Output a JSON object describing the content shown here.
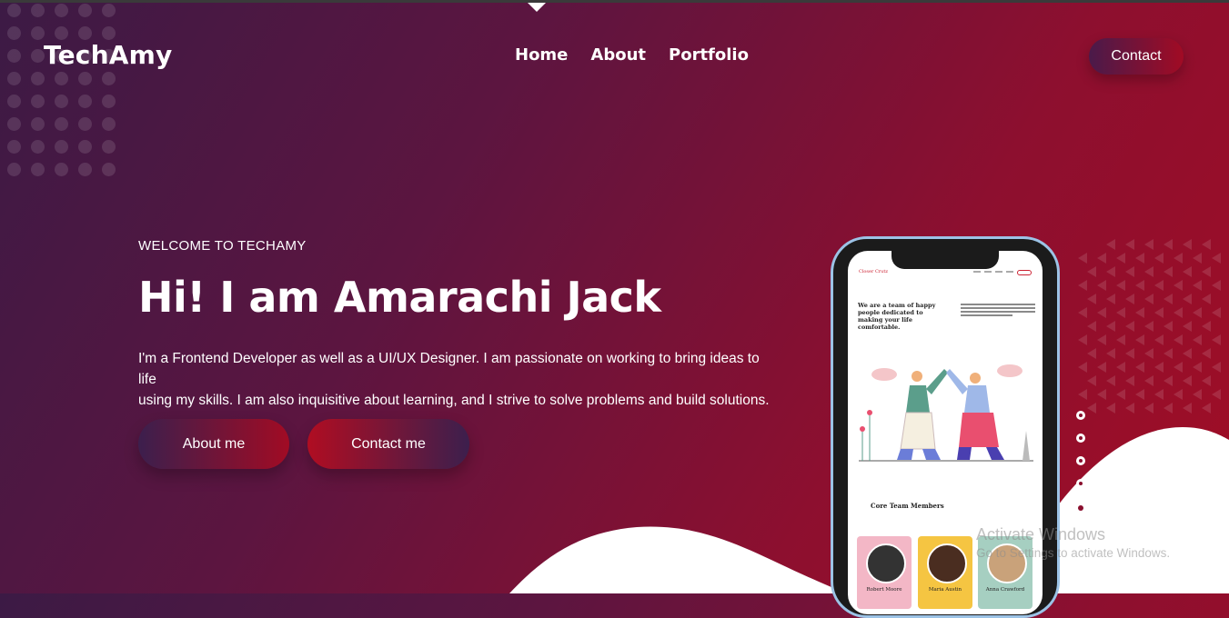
{
  "brand": {
    "logo": "TechAmy"
  },
  "nav": {
    "items": [
      "Home",
      "About",
      "Portfolio"
    ],
    "contact_label": "Contact"
  },
  "hero": {
    "eyebrow": "WELCOME TO TECHAMY",
    "title": "Hi! I am Amarachi Jack",
    "intro_line1": "I'm a Frontend Developer as well as a UI/UX Designer. I am passionate on working to bring ideas to life",
    "intro_line2": "using my skills. I am also inquisitive about learning, and I strive to solve problems and build solutions.",
    "about_button": "About me",
    "contact_button": "Contact me"
  },
  "phone_screen": {
    "site_logo": "Closer Crutz",
    "headline": "We are a team of happy people dedicated to making your life comfortable.",
    "section_title": "Core Team Members",
    "members": [
      "Robert Moore",
      "Maria Austin",
      "Anna Crawford"
    ]
  },
  "slider": {
    "count": 5,
    "active_index": 4
  },
  "watermark": {
    "line1": "Activate Windows",
    "line2": "Go to Settings to activate Windows."
  },
  "colors": {
    "accent": "#a10b24",
    "purple": "#3c1a45"
  }
}
